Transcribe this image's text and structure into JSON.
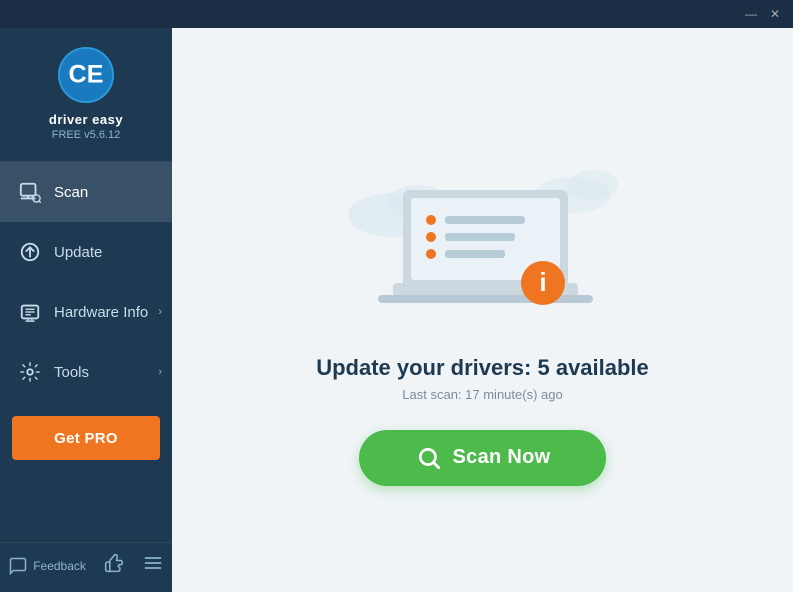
{
  "titlebar": {
    "minimize_label": "—",
    "close_label": "✕"
  },
  "sidebar": {
    "logo_title": "driver easy",
    "logo_version": "FREE v5.6.12",
    "nav_items": [
      {
        "id": "scan",
        "label": "Scan",
        "active": true,
        "has_chevron": false
      },
      {
        "id": "update",
        "label": "Update",
        "active": false,
        "has_chevron": false
      },
      {
        "id": "hardware-info",
        "label": "Hardware Info",
        "active": false,
        "has_chevron": true
      },
      {
        "id": "tools",
        "label": "Tools",
        "active": false,
        "has_chevron": true
      }
    ],
    "get_pro_label": "Get PRO",
    "feedback_label": "Feedback"
  },
  "main": {
    "heading": "Update your drivers: 5 available",
    "subtext": "Last scan: 17 minute(s) ago",
    "scan_now_label": "Scan Now"
  }
}
